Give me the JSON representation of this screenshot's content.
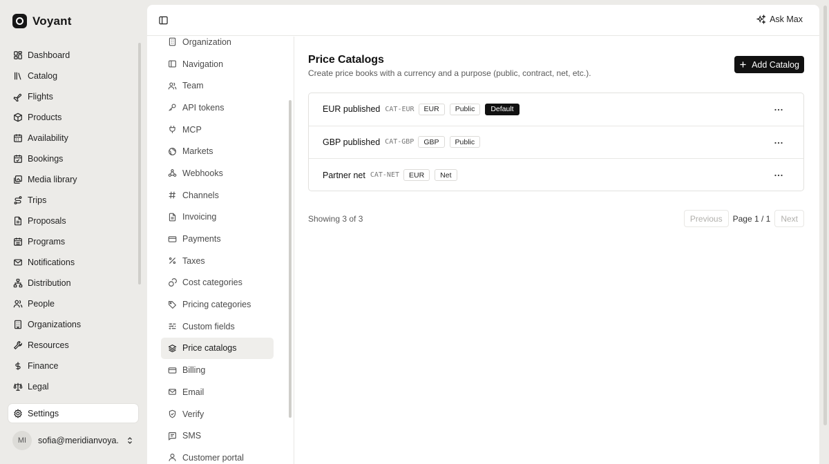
{
  "brand": {
    "name": "Voyant"
  },
  "sidebar": {
    "items": [
      {
        "label": "Dashboard",
        "icon": "dashboard-icon"
      },
      {
        "label": "Catalog",
        "icon": "library-icon"
      },
      {
        "label": "Flights",
        "icon": "plane-icon"
      },
      {
        "label": "Products",
        "icon": "package-icon"
      },
      {
        "label": "Availability",
        "icon": "calendar-icon"
      },
      {
        "label": "Bookings",
        "icon": "calendar-check-icon"
      },
      {
        "label": "Media library",
        "icon": "images-icon"
      },
      {
        "label": "Trips",
        "icon": "route-icon"
      },
      {
        "label": "Proposals",
        "icon": "file-text-icon"
      },
      {
        "label": "Programs",
        "icon": "calendar-days-icon"
      },
      {
        "label": "Notifications",
        "icon": "mail-icon"
      },
      {
        "label": "Distribution",
        "icon": "network-icon"
      },
      {
        "label": "People",
        "icon": "users-icon"
      },
      {
        "label": "Organizations",
        "icon": "building-icon"
      },
      {
        "label": "Resources",
        "icon": "wrench-icon"
      },
      {
        "label": "Finance",
        "icon": "dollar-icon"
      },
      {
        "label": "Legal",
        "icon": "scale-icon"
      }
    ],
    "settings_label": "Settings",
    "user": {
      "initials": "MI",
      "email": "sofia@meridianvoya..."
    }
  },
  "topbar": {
    "ask_label": "Ask Max"
  },
  "settings_nav": {
    "items": [
      {
        "label": "Organization"
      },
      {
        "label": "Navigation"
      },
      {
        "label": "Team"
      },
      {
        "label": "API tokens"
      },
      {
        "label": "MCP"
      },
      {
        "label": "Markets"
      },
      {
        "label": "Webhooks"
      },
      {
        "label": "Channels"
      },
      {
        "label": "Invoicing"
      },
      {
        "label": "Payments"
      },
      {
        "label": "Taxes"
      },
      {
        "label": "Cost categories"
      },
      {
        "label": "Pricing categories"
      },
      {
        "label": "Custom fields"
      },
      {
        "label": "Price catalogs"
      },
      {
        "label": "Billing"
      },
      {
        "label": "Email"
      },
      {
        "label": "Verify"
      },
      {
        "label": "SMS"
      },
      {
        "label": "Customer portal"
      }
    ],
    "active": "Price catalogs"
  },
  "page": {
    "title": "Price Catalogs",
    "subtitle": "Create price books with a currency and a purpose (public, contract, net, etc.).",
    "add_label": "Add Catalog"
  },
  "catalogs": [
    {
      "name": "EUR published",
      "code": "CAT-EUR",
      "badges": [
        "EUR",
        "Public"
      ],
      "default_badge": "Default"
    },
    {
      "name": "GBP published",
      "code": "CAT-GBP",
      "badges": [
        "GBP",
        "Public"
      ]
    },
    {
      "name": "Partner net",
      "code": "CAT-NET",
      "badges": [
        "EUR",
        "Net"
      ]
    }
  ],
  "pagination": {
    "showing": "Showing 3 of 3",
    "previous": "Previous",
    "page": "Page 1 / 1",
    "next": "Next"
  }
}
